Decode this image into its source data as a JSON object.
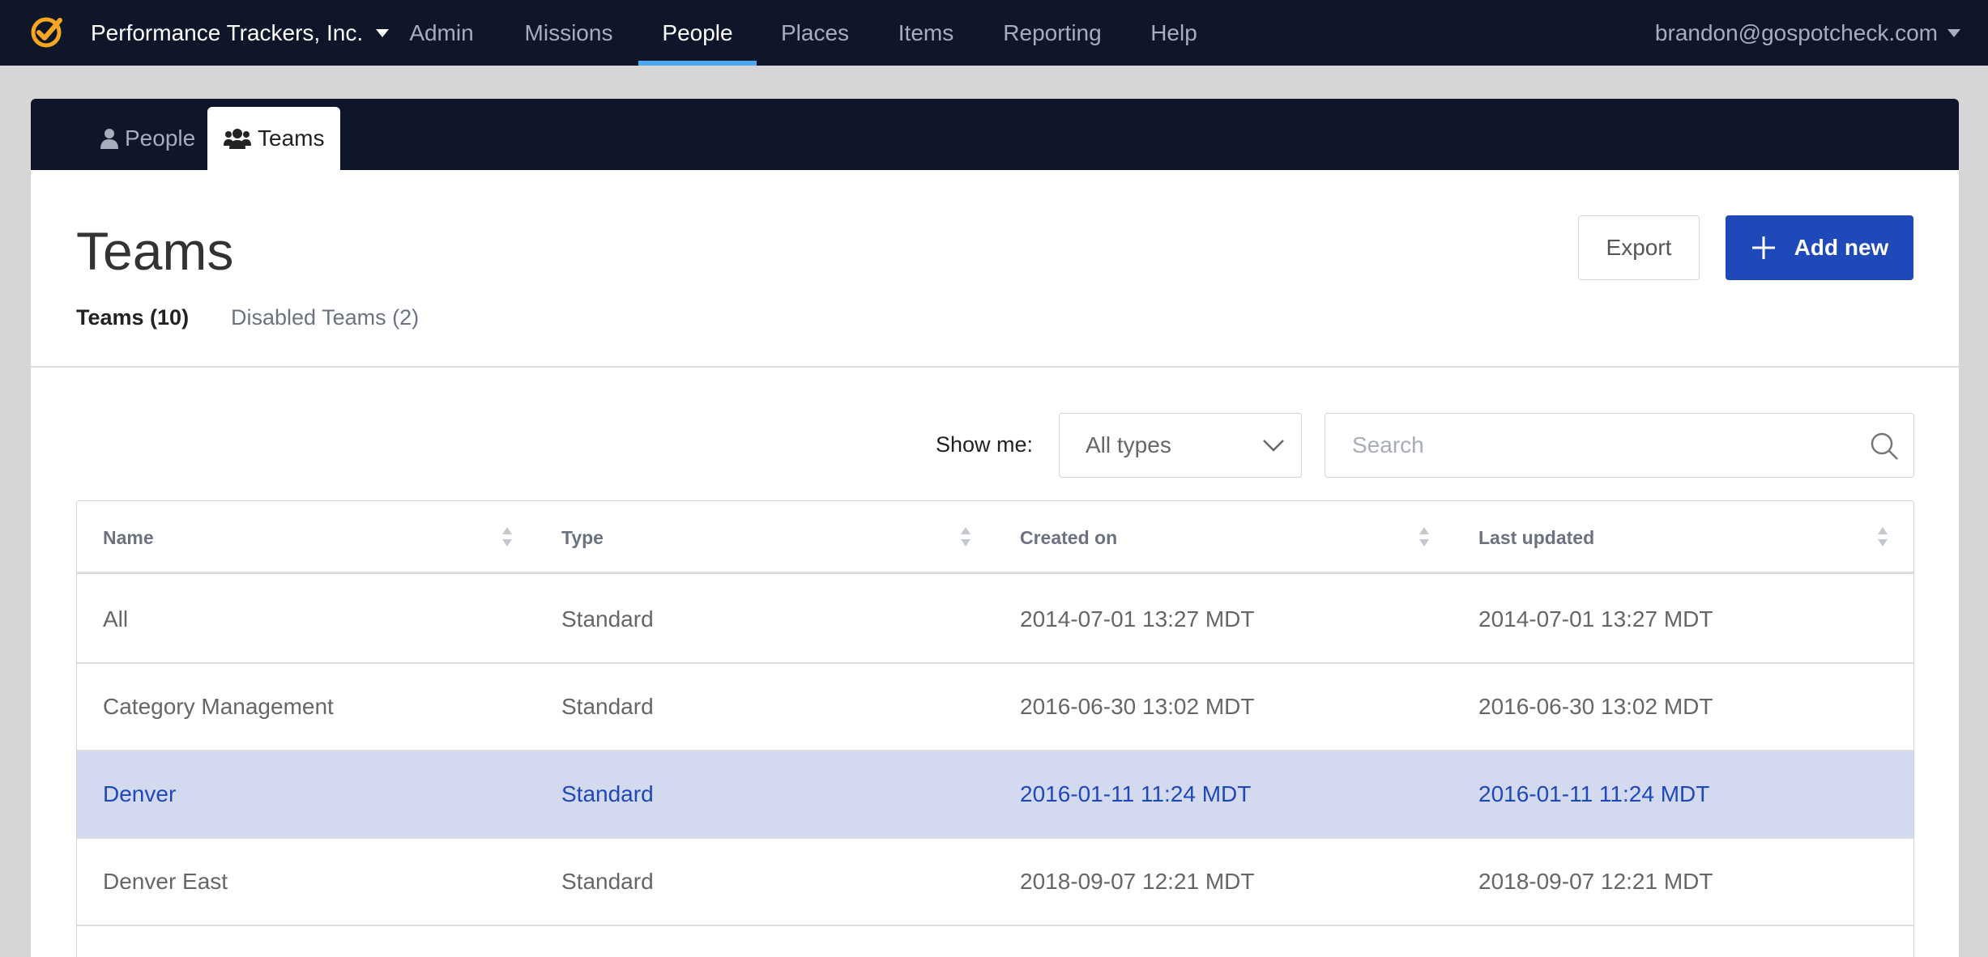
{
  "topnav": {
    "org_name": "Performance Trackers, Inc.",
    "items": [
      {
        "label": "Admin"
      },
      {
        "label": "Missions"
      },
      {
        "label": "People",
        "active": true
      },
      {
        "label": "Places"
      },
      {
        "label": "Items"
      },
      {
        "label": "Reporting"
      },
      {
        "label": "Help"
      }
    ],
    "user_email": "brandon@gospotcheck.com",
    "accent_color": "#4aa8f0",
    "logo_color": "#f5a623"
  },
  "subtabs": [
    {
      "label": "People",
      "icon": "user-icon",
      "active": false
    },
    {
      "label": "Teams",
      "icon": "users-icon",
      "active": true
    }
  ],
  "page": {
    "title": "Teams",
    "export_label": "Export",
    "add_label": "Add new",
    "primary_color": "#1f48b8"
  },
  "filters": {
    "active_label": "Teams (10)",
    "disabled_label": "Disabled Teams (2)"
  },
  "toolbar": {
    "show_me_label": "Show me:",
    "type_select_value": "All types",
    "search_placeholder": "Search"
  },
  "table": {
    "columns": [
      "Name",
      "Type",
      "Created on",
      "Last updated"
    ],
    "rows": [
      {
        "name": "All",
        "type": "Standard",
        "created": "2014-07-01 13:27 MDT",
        "updated": "2014-07-01 13:27 MDT",
        "selected": false
      },
      {
        "name": "Category Management",
        "type": "Standard",
        "created": "2016-06-30 13:02 MDT",
        "updated": "2016-06-30 13:02 MDT",
        "selected": false
      },
      {
        "name": "Denver",
        "type": "Standard",
        "created": "2016-01-11 11:24 MDT",
        "updated": "2016-01-11 11:24 MDT",
        "selected": true
      },
      {
        "name": "Denver East",
        "type": "Standard",
        "created": "2018-09-07 12:21 MDT",
        "updated": "2018-09-07 12:21 MDT",
        "selected": false
      }
    ]
  }
}
